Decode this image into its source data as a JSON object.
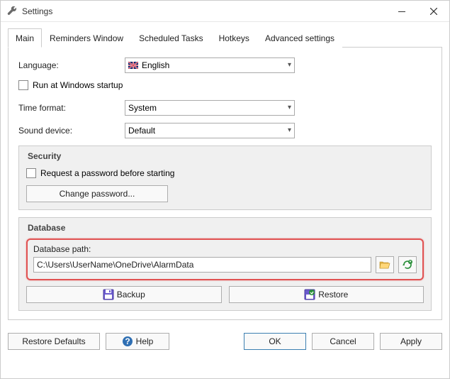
{
  "window": {
    "title": "Settings"
  },
  "tabs": [
    {
      "label": "Main"
    },
    {
      "label": "Reminders Window"
    },
    {
      "label": "Scheduled Tasks"
    },
    {
      "label": "Hotkeys"
    },
    {
      "label": "Advanced settings"
    }
  ],
  "main": {
    "language_label": "Language:",
    "language_value": "English",
    "run_startup_label": "Run at Windows startup",
    "time_format_label": "Time format:",
    "time_format_value": "System",
    "sound_device_label": "Sound device:",
    "sound_device_value": "Default"
  },
  "security": {
    "title": "Security",
    "request_password_label": "Request a password before starting",
    "change_password_label": "Change password..."
  },
  "database": {
    "title": "Database",
    "path_label": "Database path:",
    "path_value": "C:\\Users\\UserName\\OneDrive\\AlarmData",
    "backup_label": "Backup",
    "restore_label": "Restore"
  },
  "buttons": {
    "restore_defaults": "Restore Defaults",
    "help": "Help",
    "ok": "OK",
    "cancel": "Cancel",
    "apply": "Apply"
  }
}
